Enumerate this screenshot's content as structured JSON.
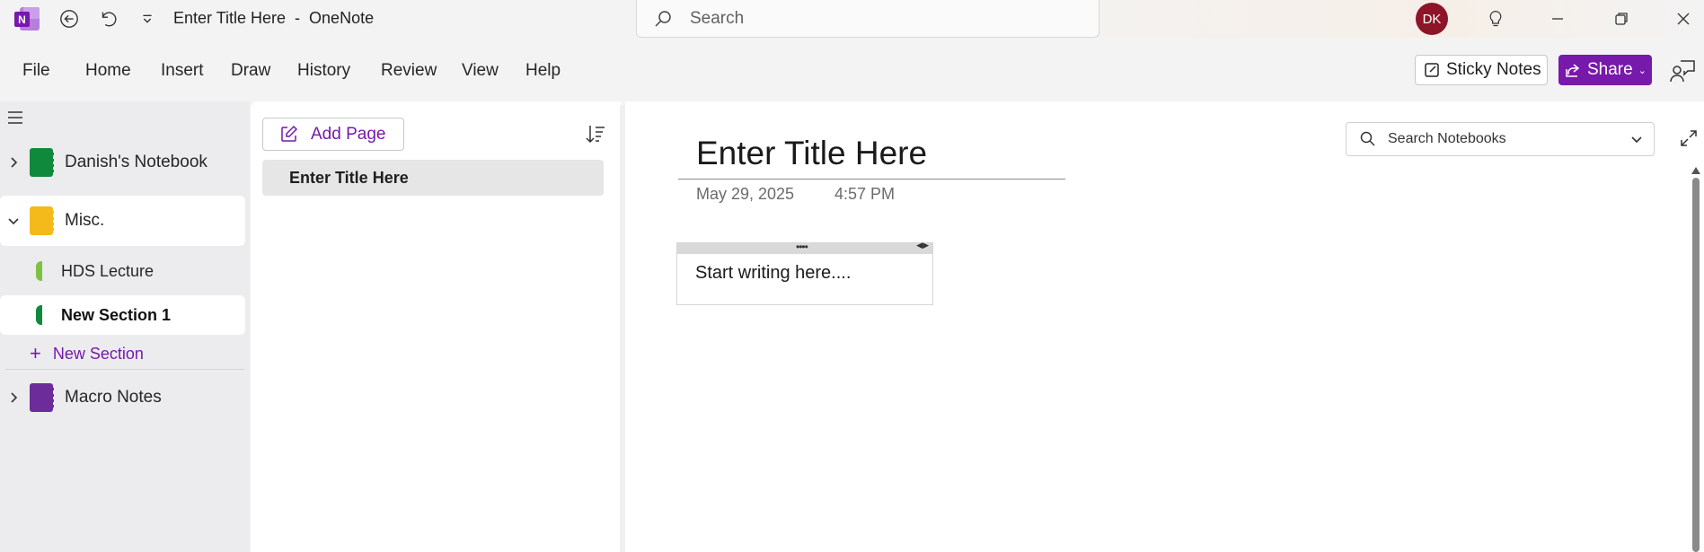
{
  "window": {
    "title": "Enter Title Here  -  OneNote",
    "search_placeholder": "Search",
    "avatar_initials": "DK"
  },
  "ribbon": {
    "menu": [
      "File",
      "Home",
      "Insert",
      "Draw",
      "History",
      "Review",
      "View",
      "Help"
    ],
    "sticky_notes": "Sticky Notes",
    "share": "Share"
  },
  "nav": {
    "notebooks": [
      {
        "label": "Danish's Notebook",
        "color": "#0f8a3c",
        "expanded": false
      },
      {
        "label": "Misc.",
        "color": "#f4b91a",
        "expanded": true
      },
      {
        "label": "Macro Notes",
        "color": "#6c2c9a",
        "expanded": false
      }
    ],
    "sections": [
      {
        "label": "HDS Lecture",
        "color": "#7fc241",
        "selected": false
      },
      {
        "label": "New Section 1",
        "color": "#0f8a3c",
        "selected": true
      }
    ],
    "new_section": "New Section"
  },
  "pages": {
    "add_page": "Add Page",
    "items": [
      {
        "label": "Enter Title Here",
        "selected": true
      }
    ]
  },
  "canvas": {
    "title": "Enter Title Here",
    "date": "May 29, 2025",
    "time": "4:57 PM",
    "note_text": "Start writing here....",
    "search_notebooks_placeholder": "Search Notebooks"
  },
  "colors": {
    "accent": "#7719aa",
    "avatar": "#8c1527"
  }
}
